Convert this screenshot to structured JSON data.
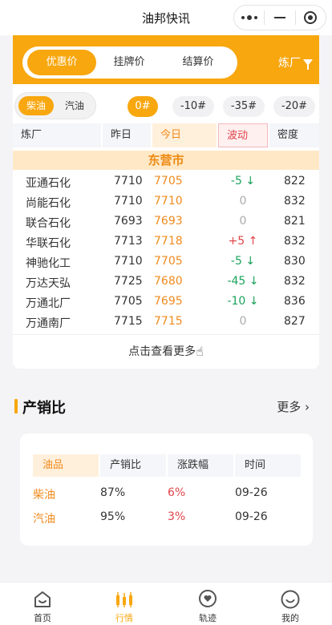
{
  "app": {
    "title": "油邦快讯"
  },
  "tabs": [
    {
      "label": "优惠价",
      "active": true
    },
    {
      "label": "挂牌价",
      "active": false
    },
    {
      "label": "结算价",
      "active": false
    }
  ],
  "refinery_filter": "炼厂",
  "fuel_types": [
    {
      "label": "柴油",
      "active": true
    },
    {
      "label": "汽油",
      "active": false
    }
  ],
  "grades": [
    {
      "label": "0#",
      "active": true
    },
    {
      "label": "-10#",
      "active": false
    },
    {
      "label": "-35#",
      "active": false
    },
    {
      "label": "-20#",
      "active": false
    }
  ],
  "table": {
    "headers": [
      "炼厂",
      "昨日",
      "今日",
      "波动",
      "密度"
    ],
    "city": "东营市",
    "rows": [
      {
        "name": "亚通石化",
        "yesterday": "7710",
        "today": "7705",
        "change": "-5",
        "dir": "down",
        "density": "822"
      },
      {
        "name": "尚能石化",
        "yesterday": "7710",
        "today": "7710",
        "change": "0",
        "dir": "flat",
        "density": "832"
      },
      {
        "name": "联合石化",
        "yesterday": "7693",
        "today": "7693",
        "change": "0",
        "dir": "flat",
        "density": "821"
      },
      {
        "name": "华联石化",
        "yesterday": "7713",
        "today": "7718",
        "change": "+5",
        "dir": "up",
        "density": "832"
      },
      {
        "name": "神驰化工",
        "yesterday": "7710",
        "today": "7705",
        "change": "-5",
        "dir": "down",
        "density": "830"
      },
      {
        "name": "万达天弘",
        "yesterday": "7725",
        "today": "7680",
        "change": "-45",
        "dir": "down",
        "density": "832"
      },
      {
        "name": "万通北厂",
        "yesterday": "7705",
        "today": "7695",
        "change": "-10",
        "dir": "down",
        "density": "836"
      },
      {
        "name": "万通南厂",
        "yesterday": "7715",
        "today": "7715",
        "change": "0",
        "dir": "flat",
        "density": "827"
      }
    ],
    "more_label": "点击查看更多"
  },
  "section": {
    "title": "产销比",
    "more_label": "更多"
  },
  "ratio_table": {
    "headers": [
      "油品",
      "产销比",
      "涨跌幅",
      "时间"
    ],
    "rows": [
      {
        "product": "柴油",
        "ratio": "87%",
        "change": "6%",
        "time": "09-26"
      },
      {
        "product": "汽油",
        "ratio": "95%",
        "change": "3%",
        "time": "09-26"
      }
    ]
  },
  "tabbar": [
    {
      "label": "首页",
      "icon": "home-icon",
      "active": false
    },
    {
      "label": "行情",
      "icon": "candlestick-icon",
      "active": true
    },
    {
      "label": "轨迹",
      "icon": "heart-chat-icon",
      "active": false
    },
    {
      "label": "我的",
      "icon": "smile-face-icon",
      "active": false
    }
  ],
  "colors": {
    "accent": "#f8a70f",
    "today": "#f08a1c",
    "up": "#e0444a",
    "down": "#1aa35a"
  }
}
